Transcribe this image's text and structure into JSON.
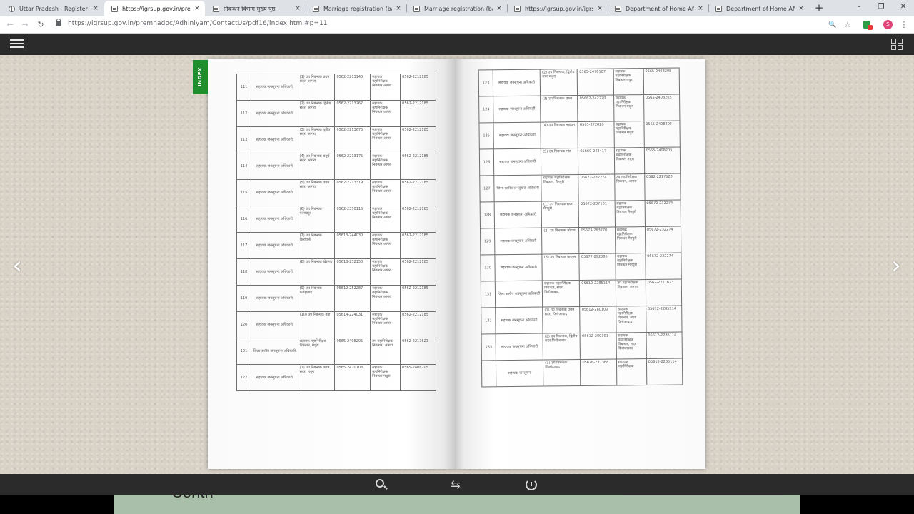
{
  "browser": {
    "tabs": [
      {
        "title": "Uttar Pradesh - Register a M",
        "favicon": "globe-icon",
        "active": false
      },
      {
        "title": "https://igrsup.gov.in/premna",
        "favicon": "page-icon",
        "active": true
      },
      {
        "title": "निबन्धन विभाग मुख्य पृष्ठ",
        "favicon": "page-icon",
        "active": false
      },
      {
        "title": "Marriage registration (basic",
        "favicon": "page-icon",
        "active": false
      },
      {
        "title": "Marriage registration (basic",
        "favicon": "page-icon",
        "active": false
      },
      {
        "title": "https://igrsup.gov.in/igrsup",
        "favicon": "page-icon",
        "active": false
      },
      {
        "title": "Department of Home Affairs",
        "favicon": "page-icon",
        "active": false
      },
      {
        "title": "Department of Home Affairs",
        "favicon": "page-icon",
        "active": false
      }
    ],
    "tab_close": "×",
    "new_tab": "+",
    "window_controls": {
      "minimize": "–",
      "restore": "❐",
      "close": "✕"
    },
    "address": {
      "back": "←",
      "forward": "→",
      "reload": "↻",
      "url": "https://igrsup.gov.in/premnadoc/Adhiniyam/ContactUs/pdf16/index.html#p=11"
    },
    "toolbar_icons": {
      "zoom": "🔍",
      "star": "☆",
      "profile_letter": "S",
      "menu": "⋮"
    }
  },
  "viewer": {
    "index_tab": "INDEX",
    "prev_arrow": "‹",
    "next_arrow": "›",
    "bottom": {
      "swap": "⇆"
    },
    "below_text": "Contn"
  },
  "left_table": {
    "rows": [
      {
        "sn": "111",
        "desig": "सहायक जनसूचना अधिकारी",
        "office": "(1) उप निबन्धक प्रथम सदर, आगरा",
        "phone": "0562-2213140",
        "appellate": "सहायक महानिरीक्षक निबन्धन आगरा",
        "phone2": "0562-2212185"
      },
      {
        "sn": "112",
        "desig": "सहायक जनसूचना अधिकारी",
        "office": "(2) उप निबन्धक द्वितीय सदर, आगरा",
        "phone": "0562-2213267",
        "appellate": "सहायक महानिरीक्षक निबन्धन आगरा",
        "phone2": "0562-2212185"
      },
      {
        "sn": "113",
        "desig": "सहायक जनसूचना अधिकारी",
        "office": "(3) उप निबन्धक तृतीय सदर, आगरा",
        "phone": "0562-2213675",
        "appellate": "सहायक महानिरीक्षक निबन्धन आगरा",
        "phone2": "0562-2212185"
      },
      {
        "sn": "114",
        "desig": "सहायक जनसूचना अधिकारी",
        "office": "(4) उप निबन्धक चतुर्थ सदर, आगरा",
        "phone": "0562-2213175",
        "appellate": "सहायक महानिरीक्षक निबन्धन आगरा",
        "phone2": "0562-2212185"
      },
      {
        "sn": "115",
        "desig": "सहायक जनसूचना अधिकारी",
        "office": "(5) उप निबन्धक पंचम सदर, आगरा",
        "phone": "0562-2213319",
        "appellate": "सहायक महानिरीक्षक निबन्धन आगरा",
        "phone2": "0562-2212185"
      },
      {
        "sn": "116",
        "desig": "सहायक जनसूचना अधिकारी",
        "office": "(6) उप निबन्धक एत्मादपुर",
        "phone": "0562-2350115",
        "appellate": "सहायक महानिरीक्षक निबन्धन आगरा",
        "phone2": "0562-2212185"
      },
      {
        "sn": "117",
        "desig": "सहायक जनसूचना अधिकारी",
        "office": "(7) उप निबन्धक किरावली",
        "phone": "05613-244030",
        "appellate": "सहायक महानिरीक्षक निबन्धन आगरा",
        "phone2": "0562-2212185"
      },
      {
        "sn": "118",
        "desig": "सहायक जनसूचना अधिकारी",
        "office": "(8) उप निबन्धक खेरागढ़",
        "phone": "05613-232150",
        "appellate": "सहायक महानिरीक्षक निबन्धन आगरा",
        "phone2": "0562-2212185"
      },
      {
        "sn": "119",
        "desig": "सहायक जनसूचना अधिकारी",
        "office": "(9) उप निबन्धक फतेहाबाद",
        "phone": "05612-252287",
        "appellate": "सहायक महानिरीक्षक निबन्धन आगरा",
        "phone2": "0562-2212185"
      },
      {
        "sn": "120",
        "desig": "सहायक जनसूचना अधिकारी",
        "office": "(10) उप निबन्धक बाह",
        "phone": "05614-224031",
        "appellate": "सहायक महानिरीक्षक निबन्धन आगरा",
        "phone2": "0562-2212185"
      },
      {
        "sn": "121",
        "desig": "जिला स्तरीय जनसूचना अधिकारी",
        "office": "सहायक महानिरीक्षक निबन्धन, मथुरा",
        "phone": "0565-2408205",
        "appellate": "उप महानिरीक्षक निबन्धन, आगरा",
        "phone2": "0562-2217623"
      },
      {
        "sn": "122",
        "desig": "सहायक जनसूचना अधिकारी",
        "office": "(1) उप निबन्धक प्रथम सदर, मथुरा",
        "phone": "0565-2470108",
        "appellate": "सहायक महानिरीक्षक निबन्धन मथुरा",
        "phone2": "0565-2408205"
      }
    ]
  },
  "right_table": {
    "rows": [
      {
        "sn": "123",
        "desig": "सहायक जनसूचना अधिकारी",
        "office": "(2) उप निबन्धक, द्वितीय सदर मथुरा",
        "phone": "0565-2470107",
        "appellate": "सहायक महानिरीक्षक निबन्धन मथुरा",
        "phone2": "0565-2408205"
      },
      {
        "sn": "124",
        "desig": "सहायक जनसूचना अधिकारी",
        "office": "(3) उप निबन्धक छाता",
        "phone": "05662-242220",
        "appellate": "सहायक महानिरीक्षक निबन्धन मथुरा",
        "phone2": "0565-2408205"
      },
      {
        "sn": "125",
        "desig": "सहायक जनसूचना अधिकारी",
        "office": "(4) उप निबन्धक महावन",
        "phone": "0565-272026",
        "appellate": "सहायक महानिरीक्षक निबन्धन मथुरा",
        "phone2": "0565-2408205"
      },
      {
        "sn": "126",
        "desig": "सहायक जनसूचना अधिकारी",
        "office": "(5) उप निबन्धक मांट",
        "phone": "05660-242417",
        "appellate": "सहायक महानिरीक्षक निबन्धन मथुरा",
        "phone2": "0565-2408205"
      },
      {
        "sn": "127",
        "desig": "जिला स्तरीय जनसूचना अधिकारी",
        "office": "सहायक महानिरीक्षक निबन्धन, मैनपुरी",
        "phone": "05672-232274",
        "appellate": "उप महानिरीक्षक निबन्धन, आगरा",
        "phone2": "0562-2217623"
      },
      {
        "sn": "128",
        "desig": "सहायक जनसूचना अधिकारी",
        "office": "(1) उप निबन्धक सदर, मैनपुरी",
        "phone": "05672-237101",
        "appellate": "सहायक महानिरीक्षक निबन्धन मैनपुरी",
        "phone2": "05672-232274"
      },
      {
        "sn": "129",
        "desig": "सहायक जनसूचना अधिकारी",
        "office": "(2) उप निबन्धक भोगांव",
        "phone": "05673-263770",
        "appellate": "सहायक महानिरीक्षक निबन्धन मैनपुरी",
        "phone2": "05672-232274"
      },
      {
        "sn": "130",
        "desig": "सहायक जनसूचना अधिकारी",
        "office": "(3) उप निबन्धक करहल",
        "phone": "05677-292005",
        "appellate": "सहायक महानिरीक्षक निबन्धन मैनपुरी",
        "phone2": "05672-232274"
      },
      {
        "sn": "131",
        "desig": "जिला स्तरीय जनसूचना अधिकारी",
        "office": "सहायक महानिरीक्षक निबन्धन, सदर फिरोजाबाद",
        "phone": "05612-2285114",
        "appellate": "उप महानिरीक्षक निबन्धन, आगरा",
        "phone2": "0562-2217623"
      },
      {
        "sn": "132",
        "desig": "सहायक जनसूचना अधिकारी",
        "office": "(1) उप निबन्धक प्रथम सदर, फिरोजाबाद",
        "phone": "05612-280100",
        "appellate": "सहायक महानिरीक्षक निबन्धन, सदर फिरोजाबाद",
        "phone2": "05612-2285114"
      },
      {
        "sn": "133",
        "desig": "सहायक जनसूचना अधिकारी",
        "office": "(2) उप निबन्धक, द्वितीय सदर फिरोजाबाद",
        "phone": "05612-280101",
        "appellate": "सहायक महानिरीक्षक निबन्धन, सदर फिरोजाबाद",
        "phone2": "05612-2285114"
      },
      {
        "sn": "",
        "desig": "सहायक जनसूचना",
        "office": "(3) उप निबन्धक शिकोहाबाद",
        "phone": "05676-237368",
        "appellate": "सहायक महानिरीक्षक",
        "phone2": "05612-2285114"
      }
    ]
  }
}
